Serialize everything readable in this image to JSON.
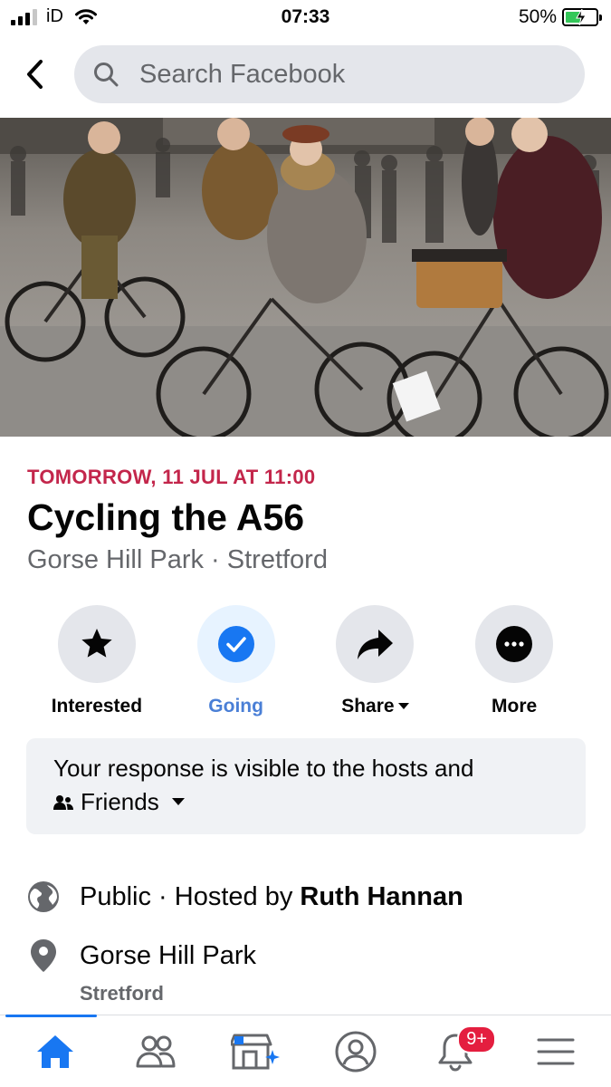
{
  "status_bar": {
    "carrier": "iD",
    "time": "07:33",
    "battery": "50%",
    "battery_level": 0.5
  },
  "search": {
    "placeholder": "Search Facebook"
  },
  "event": {
    "date": "TOMORROW, 11 JUL AT 11:00",
    "title": "Cycling the A56",
    "location": "Gorse Hill Park · Stretford"
  },
  "actions": [
    {
      "label": "Interested",
      "icon": "star-icon"
    },
    {
      "label": "Going",
      "icon": "check-circle-icon",
      "selected": true
    },
    {
      "label": "Share",
      "icon": "share-arrow-icon"
    },
    {
      "label": "More",
      "icon": "more-dots-icon"
    }
  ],
  "response": {
    "text": "Your response is visible to the hosts and",
    "audience": "Friends"
  },
  "details": {
    "privacy": "Public · Hosted by",
    "host": "Ruth Hannan",
    "place": "Gorse Hill Park",
    "place_sub": "Stretford"
  },
  "bottom_nav": {
    "items": [
      "home-icon",
      "friends-icon",
      "marketplace-icon",
      "profile-icon",
      "notifications-icon",
      "menu-icon"
    ],
    "notifications_badge": "9+"
  },
  "colors": {
    "accent": "#1877f2",
    "date": "#c3264b",
    "going": "#4a7fd6",
    "badge": "#e41e3f"
  }
}
